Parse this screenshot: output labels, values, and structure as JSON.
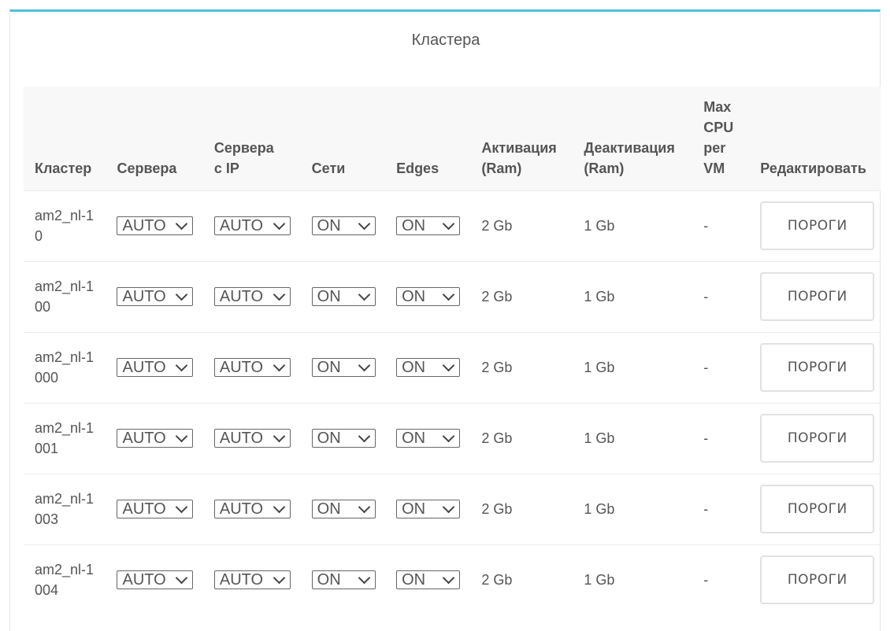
{
  "panel": {
    "title": "Кластера"
  },
  "table": {
    "headers": {
      "cluster": "Кластер",
      "servers": "Сервера",
      "servers_ip": "Сервера с IP",
      "networks": "Сети",
      "edges": "Edges",
      "activation": "Активация (Ram)",
      "deactivation": "Деактивация (Ram)",
      "max_cpu": "Max CPU per VM",
      "edit": "Редактировать"
    },
    "rows": [
      {
        "name": "am2_nl-10",
        "servers": "AUTO",
        "servers_ip": "AUTO",
        "networks": "ON",
        "edges": "ON",
        "activation": "2 Gb",
        "deactivation": "1 Gb",
        "max_cpu": "-",
        "button": "ПОРОГИ"
      },
      {
        "name": "am2_nl-100",
        "servers": "AUTO",
        "servers_ip": "AUTO",
        "networks": "ON",
        "edges": "ON",
        "activation": "2 Gb",
        "deactivation": "1 Gb",
        "max_cpu": "-",
        "button": "ПОРОГИ"
      },
      {
        "name": "am2_nl-1000",
        "servers": "AUTO",
        "servers_ip": "AUTO",
        "networks": "ON",
        "edges": "ON",
        "activation": "2 Gb",
        "deactivation": "1 Gb",
        "max_cpu": "-",
        "button": "ПОРОГИ"
      },
      {
        "name": "am2_nl-1001",
        "servers": "AUTO",
        "servers_ip": "AUTO",
        "networks": "ON",
        "edges": "ON",
        "activation": "2 Gb",
        "deactivation": "1 Gb",
        "max_cpu": "-",
        "button": "ПОРОГИ"
      },
      {
        "name": "am2_nl-1003",
        "servers": "AUTO",
        "servers_ip": "AUTO",
        "networks": "ON",
        "edges": "ON",
        "activation": "2 Gb",
        "deactivation": "1 Gb",
        "max_cpu": "-",
        "button": "ПОРОГИ"
      },
      {
        "name": "am2_nl-1004",
        "servers": "AUTO",
        "servers_ip": "AUTO",
        "networks": "ON",
        "edges": "ON",
        "activation": "2 Gb",
        "deactivation": "1 Gb",
        "max_cpu": "-",
        "button": "ПОРОГИ"
      }
    ]
  }
}
